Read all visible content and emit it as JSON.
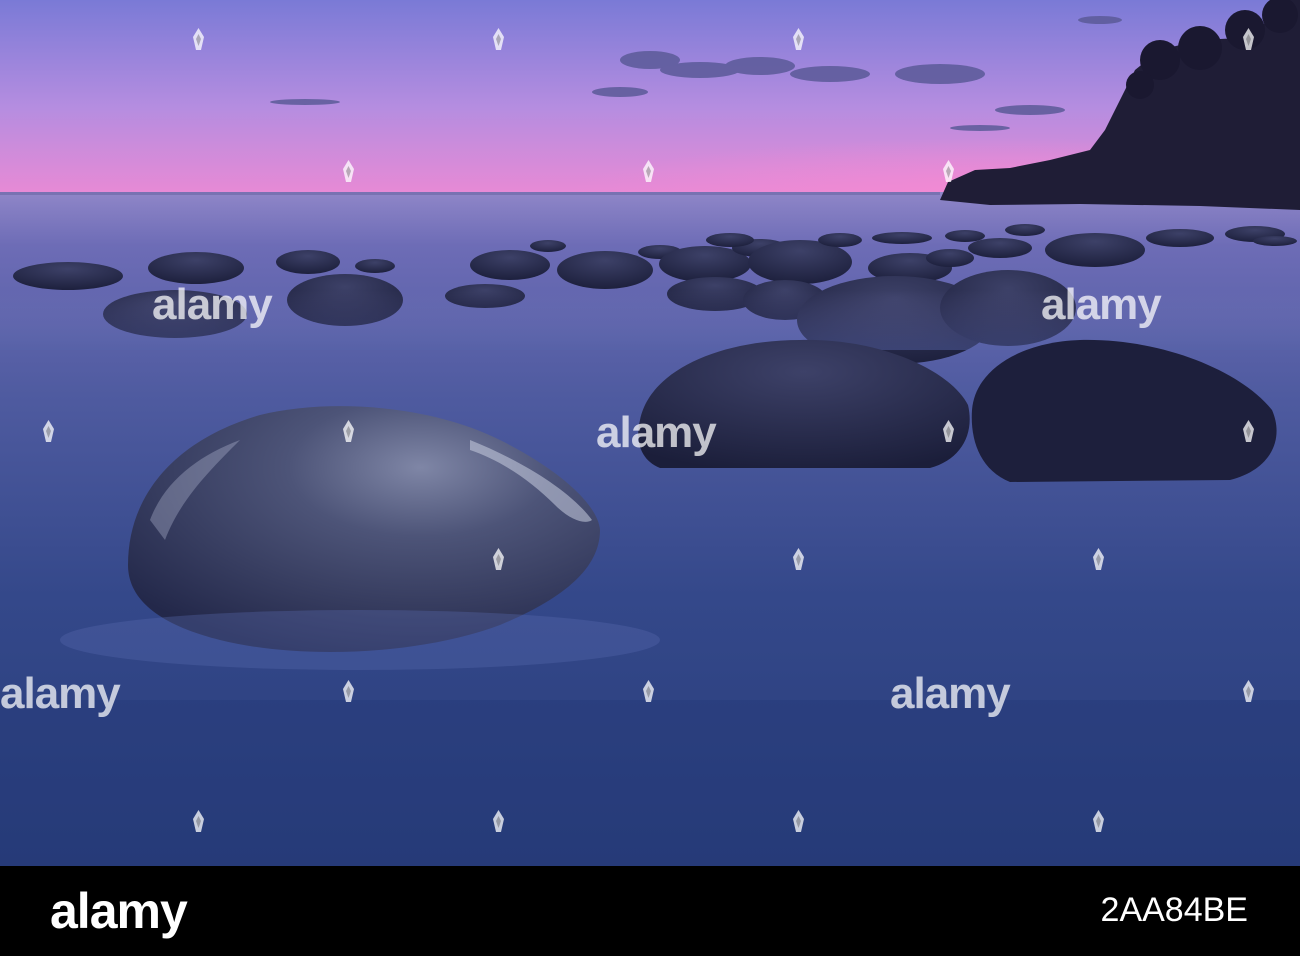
{
  "watermark": {
    "text": "alamy",
    "color": "#ffffff"
  },
  "footer": {
    "logo_text": "alamy",
    "image_id": "2AA84BE",
    "background": "#000000"
  },
  "scene": {
    "description_colors": {
      "sky_top": "#7f7cd6",
      "sky_horizon": "#e38ad6",
      "water": "#2d3f7a",
      "boulders": "#1f2340"
    }
  }
}
